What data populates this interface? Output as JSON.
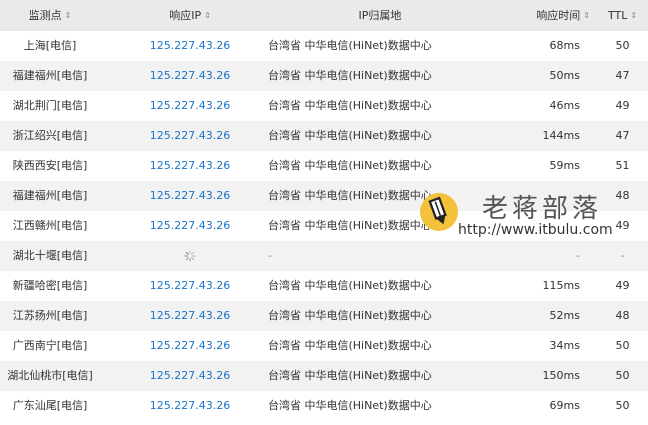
{
  "header": {
    "location": "监测点",
    "ip": "响应IP",
    "attribution": "IP归属地",
    "time": "响应时间",
    "ttl": "TTL"
  },
  "rows": [
    {
      "location": "上海[电信]",
      "ip": "125.227.43.26",
      "attribution": "台湾省 中华电信(HiNet)数据中心",
      "time": "68ms",
      "ttl": "50"
    },
    {
      "location": "福建福州[电信]",
      "ip": "125.227.43.26",
      "attribution": "台湾省 中华电信(HiNet)数据中心",
      "time": "50ms",
      "ttl": "47"
    },
    {
      "location": "湖北荆门[电信]",
      "ip": "125.227.43.26",
      "attribution": "台湾省 中华电信(HiNet)数据中心",
      "time": "46ms",
      "ttl": "49"
    },
    {
      "location": "浙江绍兴[电信]",
      "ip": "125.227.43.26",
      "attribution": "台湾省 中华电信(HiNet)数据中心",
      "time": "144ms",
      "ttl": "47"
    },
    {
      "location": "陕西西安[电信]",
      "ip": "125.227.43.26",
      "attribution": "台湾省 中华电信(HiNet)数据中心",
      "time": "59ms",
      "ttl": "51"
    },
    {
      "location": "福建福州[电信]",
      "ip": "125.227.43.26",
      "attribution": "台湾省 中华电信(HiNet)数据中心",
      "time": "",
      "ttl": "48"
    },
    {
      "location": "江西赣州[电信]",
      "ip": "125.227.43.26",
      "attribution": "台湾省 中华电信(HiNet)数据中心",
      "time": "",
      "ttl": "49"
    },
    {
      "location": "湖北十堰[电信]",
      "ip": "",
      "attribution": "-",
      "time": "-",
      "ttl": "-"
    },
    {
      "location": "新疆哈密[电信]",
      "ip": "125.227.43.26",
      "attribution": "台湾省 中华电信(HiNet)数据中心",
      "time": "115ms",
      "ttl": "49"
    },
    {
      "location": "江苏扬州[电信]",
      "ip": "125.227.43.26",
      "attribution": "台湾省 中华电信(HiNet)数据中心",
      "time": "52ms",
      "ttl": "48"
    },
    {
      "location": "广西南宁[电信]",
      "ip": "125.227.43.26",
      "attribution": "台湾省 中华电信(HiNet)数据中心",
      "time": "34ms",
      "ttl": "50"
    },
    {
      "location": "湖北仙桃市[电信]",
      "ip": "125.227.43.26",
      "attribution": "台湾省 中华电信(HiNet)数据中心",
      "time": "150ms",
      "ttl": "50"
    },
    {
      "location": "广东汕尾[电信]",
      "ip": "125.227.43.26",
      "attribution": "台湾省 中华电信(HiNet)数据中心",
      "time": "69ms",
      "ttl": "50"
    }
  ],
  "watermark": {
    "title": "老蒋部落",
    "url": "http://www.itbulu.com"
  },
  "icons": {
    "sort": "sort-icon",
    "loading": "loading-spinner-icon",
    "logo": "pencil-logo-icon"
  }
}
